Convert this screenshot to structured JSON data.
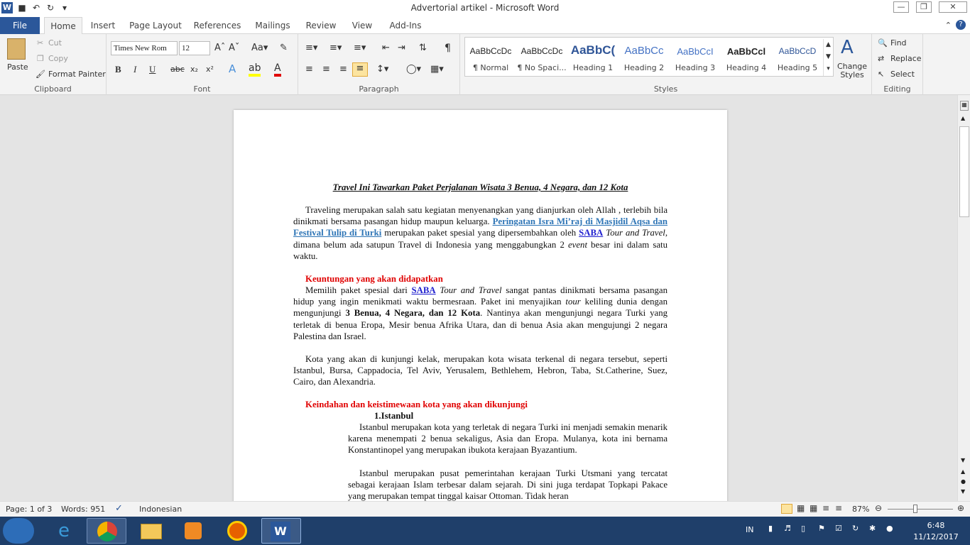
{
  "window": {
    "title": "Advertorial artikel  -  Microsoft Word"
  },
  "tabs": [
    "File",
    "Home",
    "Insert",
    "Page Layout",
    "References",
    "Mailings",
    "Review",
    "View",
    "Add-Ins"
  ],
  "clipboard": {
    "paste": "Paste",
    "cut": "Cut",
    "copy": "Copy",
    "format_painter": "Format Painter",
    "label": "Clipboard"
  },
  "font": {
    "name": "Times New Rom",
    "size": "12",
    "label": "Font",
    "bold": "B",
    "italic": "I",
    "underline": "U",
    "strike": "abc",
    "sub": "x₂",
    "sup": "x²"
  },
  "paragraph": {
    "label": "Paragraph"
  },
  "styles": {
    "label": "Styles",
    "items": [
      {
        "preview": "AaBbCcDc",
        "name": "¶ Normal"
      },
      {
        "preview": "AaBbCcDc",
        "name": "¶ No Spaci..."
      },
      {
        "preview": "AaBbC(",
        "name": "Heading 1"
      },
      {
        "preview": "AaBbCc",
        "name": "Heading 2"
      },
      {
        "preview": "AaBbCcI",
        "name": "Heading 3"
      },
      {
        "preview": "AaBbCcl",
        "name": "Heading 4"
      },
      {
        "preview": "AaBbCcD",
        "name": "Heading 5"
      }
    ],
    "change": "Change Styles"
  },
  "editing": {
    "find": "Find",
    "replace": "Replace",
    "select": "Select",
    "label": "Editing"
  },
  "doc": {
    "title": "Travel Ini Tawarkan Paket Perjalanan Wisata 3 Benua, 4 Negara, dan 12 Kota",
    "p1a": "Traveling merupakan salah satu kegiatan menyenangkan yang dianjurkan oleh Allah , terlebih bila dinikmati bersama pasangan hidup maupun keluarga.",
    "p1link": "Peringatan Isra Mi’raj di Masjidil Aqsa dan Festival Tulip di Turki",
    "p1b": "merupakan paket spesial  yang dipersembahkan oleh",
    "saba": "SABA",
    "tt": "Tour and Travel",
    "p1c": ", dimana belum ada satupun Travel di Indonesia yang menggabungkan 2",
    "event": "event",
    "p1d": "besar ini dalam satu waktu.",
    "h1": "Keuntungan yang akan didapatkan",
    "p2a": "Memilih paket spesial dari",
    "p2b": "sangat pantas dinikmati bersama pasangan hidup yang ingin menikmati waktu bermesraan. Paket ini menyajikan",
    "tour": "tour",
    "p2c": "keliling dunia dengan mengunjungi",
    "p2bold": "3 Benua, 4 Negara, dan 12 Kota",
    "p2d": ". Nantinya akan mengunjungi negara Turki yang terletak di benua Eropa, Mesir benua Afrika Utara, dan di benua Asia akan mengujungi 2 negara Palestina dan Israel.",
    "p3": "Kota yang akan di kunjungi kelak, merupakan kota wisata terkenal di negara tersebut, seperti Istanbul, Bursa, Cappadocia, Tel Aviv, Yerusalem, Bethlehem, Hebron, Taba, St.Catherine, Suez, Cairo, dan Alexandria.",
    "h2": "Keindahan dan keistimewaan kota yang akan dikunjungi",
    "list1": "1.Istanbul",
    "p4": "Istanbul merupakan kota yang terletak di negara Turki ini menjadi semakin menarik karena menempati 2 benua sekaligus, Asia dan Eropa. Mulanya, kota ini bernama Konstantinopel yang merupakan ibukota kerajaan Byazantium.",
    "p5": "Istanbul merupakan pusat pemerintahan kerajaan Turki Utsmani yang tercatat sebagai kerajaan Islam terbesar dalam sejarah. Di sini juga terdapat Topkapi Pakace yang merupakan tempat tinggal kaisar Ottoman. Tidak heran"
  },
  "status": {
    "page": "Page: 1 of 3",
    "words": "Words: 951",
    "lang": "Indonesian",
    "zoom": "87%"
  },
  "tray": {
    "lang": "IN",
    "time": "6:48",
    "date": "11/12/2017"
  }
}
